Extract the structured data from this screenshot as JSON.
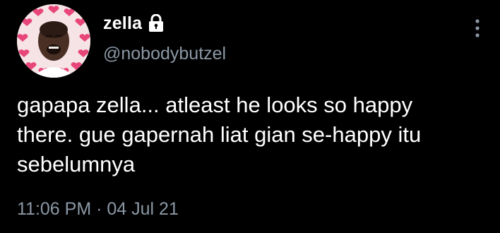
{
  "user": {
    "display_name": "zella",
    "handle": "@nobodybutzel",
    "protected_icon": "lock-icon",
    "avatar_icon": "avatar-crying-face-with-hearts"
  },
  "tweet": {
    "text_lines": [
      "gapapa zella... atleast he looks so happy",
      "there. gue gapernah liat gian se-happy itu",
      "sebelumnya"
    ],
    "time": "11:06 PM",
    "separator": "·",
    "date": "04 Jul 21"
  },
  "menu": {
    "more_icon": "more-vertical-icon"
  },
  "colors": {
    "background": "#000000",
    "primary_text": "#ffffff",
    "secondary_text": "#8b98a5",
    "heart": "#e8467a"
  }
}
